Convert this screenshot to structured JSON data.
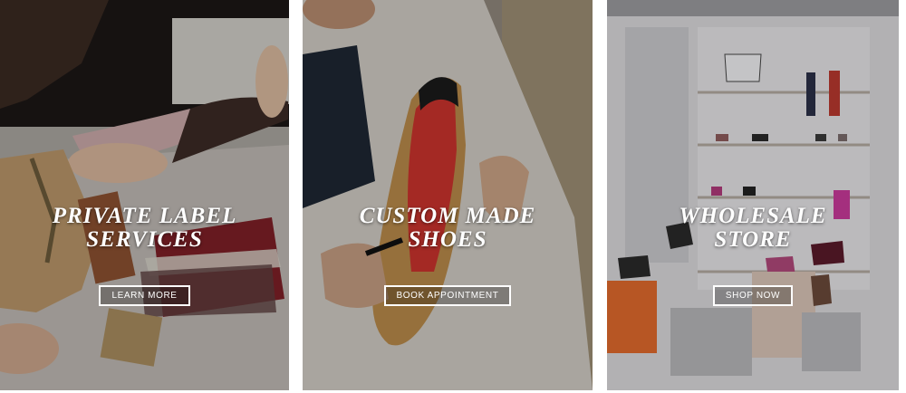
{
  "cards": [
    {
      "title_line1": "PRIVATE LABEL",
      "title_line2": "SERVICES",
      "button_label": "LEARN MORE"
    },
    {
      "title_line1": "CUSTOM MADE",
      "title_line2": "SHOES",
      "button_label": "BOOK APPOINTMENT"
    },
    {
      "title_line1": "WHOLESALE",
      "title_line2": "STORE",
      "button_label": "SHOP NOW"
    }
  ],
  "colors": {
    "text": "#ffffff",
    "page_background": "#ffffff",
    "sole_red": "#c8332c",
    "leather_tan": "#b88a4a"
  }
}
